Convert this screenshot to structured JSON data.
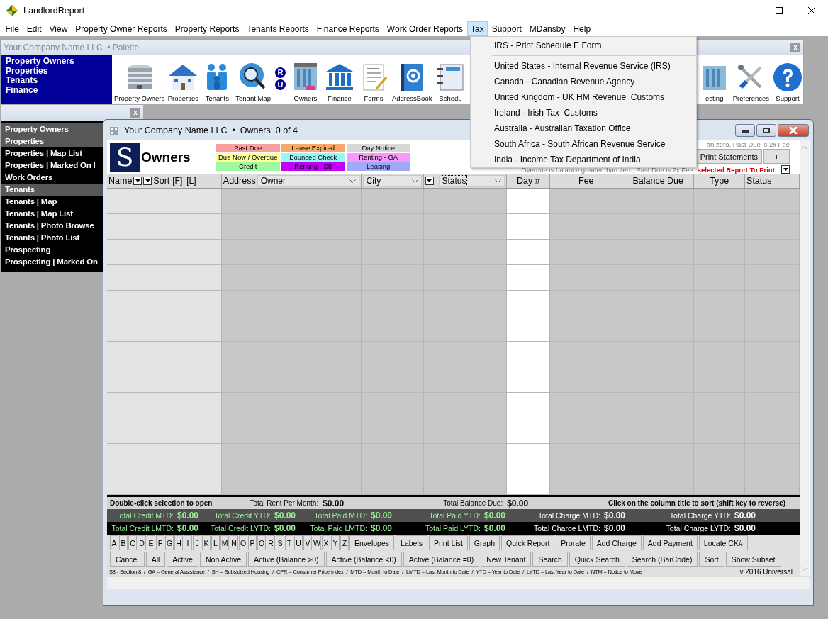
{
  "window": {
    "title": "LandlordReport"
  },
  "menu": [
    {
      "label": "File",
      "selected": false
    },
    {
      "label": "Edit",
      "selected": false
    },
    {
      "label": "View",
      "selected": false
    },
    {
      "label": "Property Owner Reports",
      "selected": false
    },
    {
      "label": "Property Reports",
      "selected": false
    },
    {
      "label": "Tenants Reports",
      "selected": false
    },
    {
      "label": "Finance Reports",
      "selected": false
    },
    {
      "label": "Work Order Reports",
      "selected": false
    },
    {
      "label": "Tax",
      "selected": true
    },
    {
      "label": "Support",
      "selected": false
    },
    {
      "label": "MDansby",
      "selected": false
    },
    {
      "label": "Help",
      "selected": false
    }
  ],
  "tax_menu": [
    {
      "kind": "item",
      "label": "IRS - Print Schedule E Form"
    },
    {
      "kind": "separator"
    },
    {
      "kind": "item",
      "label": "United States - Internal Revenue Service (IRS)"
    },
    {
      "kind": "item",
      "label": "Canada - Canadian Revenue Agency"
    },
    {
      "kind": "item",
      "label": "United Kingdom - UK HM Revenue  Customs"
    },
    {
      "kind": "item",
      "label": "Ireland - Irish Tax  Customs"
    },
    {
      "kind": "item",
      "label": "Australia - Australian Taxation Office"
    },
    {
      "kind": "item",
      "label": "South Africa - South African Revenue Service"
    },
    {
      "kind": "item",
      "label": "India - Income Tax Department of India"
    }
  ],
  "palette": {
    "title": "Your Company Name LLC  • Palette",
    "close": "x",
    "nav": [
      "Property Owners",
      "Properties",
      "Tenants",
      "Finance"
    ],
    "badges": [
      "R",
      "U"
    ],
    "tools_left": [
      {
        "kind": "office",
        "label": "Property Owners"
      },
      {
        "kind": "house",
        "label": "Properties"
      },
      {
        "kind": "people",
        "label": "Tenants"
      },
      {
        "kind": "magnifier",
        "label": "Tenant Map"
      },
      {
        "kind": "badges"
      },
      {
        "kind": "tower",
        "label": "Owners"
      },
      {
        "kind": "bank",
        "label": "Finance"
      },
      {
        "kind": "document",
        "label": "Forms"
      },
      {
        "kind": "book",
        "label": "AddressBook"
      },
      {
        "kind": "planner",
        "label": "Schedu"
      }
    ],
    "tools_right": [
      {
        "kind": "tower",
        "label": "ecting"
      },
      {
        "kind": "tools",
        "label": "Preferences"
      },
      {
        "kind": "help",
        "label": "Support"
      }
    ]
  },
  "side_panel": {
    "close": "x",
    "items": [
      {
        "kind": "header",
        "label": "Property Owners"
      },
      {
        "kind": "header",
        "label": "Properties"
      },
      {
        "kind": "item",
        "label": "Properties | Map List"
      },
      {
        "kind": "item",
        "label": "Properties | Marked On I"
      },
      {
        "kind": "item",
        "label": "Work Orders"
      },
      {
        "kind": "header",
        "label": "Tenants"
      },
      {
        "kind": "item",
        "label": "Tenants | Map"
      },
      {
        "kind": "item",
        "label": "Tenants | Map List"
      },
      {
        "kind": "item",
        "label": "Tenants | Photo Browse"
      },
      {
        "kind": "item",
        "label": "Tenants | Photo List"
      },
      {
        "kind": "item",
        "label": "Prospecting"
      },
      {
        "kind": "item",
        "label": "Prospecting | Marked On"
      }
    ]
  },
  "owners_window": {
    "title": "Your Company Name LLC  •  Owners: 0 of 4",
    "logo": "S",
    "heading": "Owners",
    "legend": [
      {
        "label": "Past Due",
        "color": "#f8a0a0"
      },
      {
        "label": "Lease Expired",
        "color": "#f8a868"
      },
      {
        "label": "Day Notice",
        "color": "#d8d8d8"
      },
      {
        "label": "Due Now / Overdue",
        "color": "#ffff98"
      },
      {
        "label": "Bounced Check",
        "color": "#98f8f8"
      },
      {
        "label": "Renting - GA",
        "color": "#f898f8"
      },
      {
        "label": "Credit",
        "color": "#a0f8a0"
      },
      {
        "label": "Renting - S8",
        "color": "#c000f8"
      },
      {
        "label": "Leasing",
        "color": "#a0a8f8"
      }
    ],
    "note_top": "an zero, Past Due is 2x Fee",
    "header_buttons": [
      "Print Statements",
      "+"
    ],
    "note": "Overdue is balance greater than zero, Past Due is 2x Fee",
    "report_label": "selected Report To Print:",
    "filters": {
      "name": "Name",
      "sort": "Sort",
      "sort_first": "[F]",
      "sort_last": "[L]",
      "address": "Address",
      "owner": "Owner",
      "city": "City",
      "status": "Status"
    },
    "columns": [
      "Day #",
      "Fee",
      "Balance Due",
      "Type",
      "Status"
    ],
    "summary": {
      "hint": "Double-click selection to open",
      "rent_label": "Total Rent Per Month:",
      "rent": "$0.00",
      "balance_label": "Total Balance Due:",
      "balance": "$0.00",
      "sort_hint": "Click on the column title to sort (shift key to reverse)"
    },
    "totals": [
      [
        {
          "kind": "credit",
          "label": "Total Credit MTD:",
          "value": "$0.00"
        },
        {
          "kind": "credit",
          "label": "Total Credit YTD:",
          "value": "$0.00"
        },
        {
          "kind": "credit",
          "label": "Total Paid MTD:",
          "value": "$0.00"
        },
        {
          "kind": "credit",
          "label": "Total Paid YTD:",
          "value": "$0.00"
        },
        {
          "kind": "charge",
          "label": "Total Charge MTD:",
          "value": "$0.00"
        },
        {
          "kind": "charge",
          "label": "Total Charge YTD:",
          "value": "$0.00"
        }
      ],
      [
        {
          "kind": "credit",
          "label": "Total Credit LMTD:",
          "value": "$0.00"
        },
        {
          "kind": "credit",
          "label": "Total Credit LYTD:",
          "value": "$0.00"
        },
        {
          "kind": "credit",
          "label": "Total Paid LMTD:",
          "value": "$0.00"
        },
        {
          "kind": "credit",
          "label": "Total Paid LYTD:",
          "value": "$0.00"
        },
        {
          "kind": "charge",
          "label": "Total Charge LMTD:",
          "value": "$0.00"
        },
        {
          "kind": "charge",
          "label": "Total Charge LYTD:",
          "value": "$0.00"
        }
      ]
    ],
    "letters": [
      "A",
      "B",
      "C",
      "D",
      "E",
      "F",
      "G",
      "H",
      "I",
      "J",
      "K",
      "L",
      "M",
      "N",
      "O",
      "P",
      "Q",
      "R",
      "S",
      "T",
      "U",
      "V",
      "W",
      "X",
      "Y",
      "Z"
    ],
    "actions": [
      "Envelopes",
      "Labels",
      "Print List",
      "Graph",
      "Quick Report",
      "Prorate",
      "Add Charge",
      "Add Payment",
      "Locate CK#"
    ],
    "filter_buttons": [
      "Cancel",
      "All",
      "Active",
      "Non Active",
      "Active (Balance >0)",
      "Active (Balance <0)",
      "Active (Balance =0)",
      "New Tenant",
      "Search",
      "Quick Search",
      "Search (BarCode)",
      "Sort",
      "Show Subset"
    ],
    "footnote": "S8 - Section 8  /  GA = General Assistance  /  SH = Subsidized Housing  /  CPR = Consumer Price Index  /  MTD = Month to Date  /  LMTD = Last Month to Date  /  YTD = Year to Date  /  LYTD = Last Year to Date  /  NTM = Notice to Move",
    "version": "v 2016 Universal"
  }
}
